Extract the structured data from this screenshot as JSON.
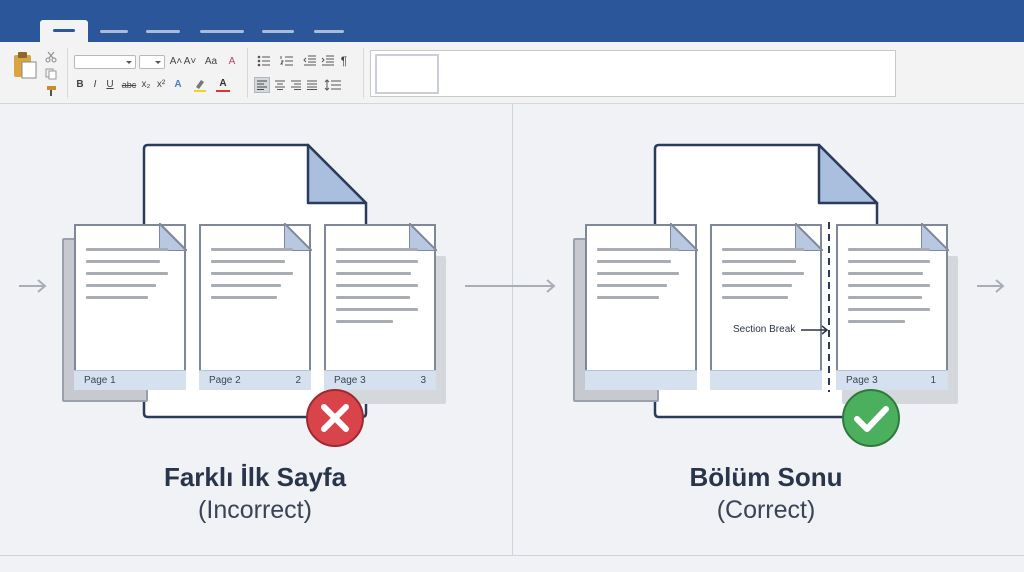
{
  "ribbon": {
    "font_name": "",
    "font_size": "",
    "btn_grow_font": "A˄",
    "btn_shrink_font": "A˅",
    "btn_case": "Aa",
    "btn_clear": "A",
    "btn_bold": "B",
    "btn_italic": "I",
    "btn_strike": "abc",
    "btn_subscript": "x₂",
    "btn_superscript": "x²",
    "btn_text_effects": "A",
    "btn_font_color": "A",
    "btn_pilcrow": "¶"
  },
  "left_panel": {
    "pages": [
      {
        "label": "Page 1",
        "number": ""
      },
      {
        "label": "Page 2",
        "number": "2"
      },
      {
        "label": "Page 3",
        "number": "3"
      }
    ],
    "title": "Farklı İlk Sayfa",
    "subtitle": "(Incorrect)",
    "status": "incorrect"
  },
  "right_panel": {
    "pages": [
      {
        "label": "",
        "number": ""
      },
      {
        "label": "",
        "number": ""
      },
      {
        "label": "Page 3",
        "number": "1"
      }
    ],
    "section_break_label": "Section Break",
    "title": "Bölüm Sonu",
    "subtitle": "(Correct)",
    "status": "correct"
  },
  "colors": {
    "title_bar": "#2b579a",
    "incorrect": "#d9434a",
    "correct": "#4caf5e",
    "footer_band": "#d6e1ef"
  },
  "icons": [
    "paste-icon",
    "cut-icon",
    "copy-icon",
    "format-painter-icon",
    "bullets-icon",
    "numbering-icon",
    "decrease-indent-icon",
    "increase-indent-icon",
    "pilcrow-icon",
    "align-left-icon",
    "align-center-icon",
    "align-right-icon",
    "justify-icon",
    "line-spacing-icon",
    "arrow-right-icon",
    "x-icon",
    "check-icon"
  ]
}
